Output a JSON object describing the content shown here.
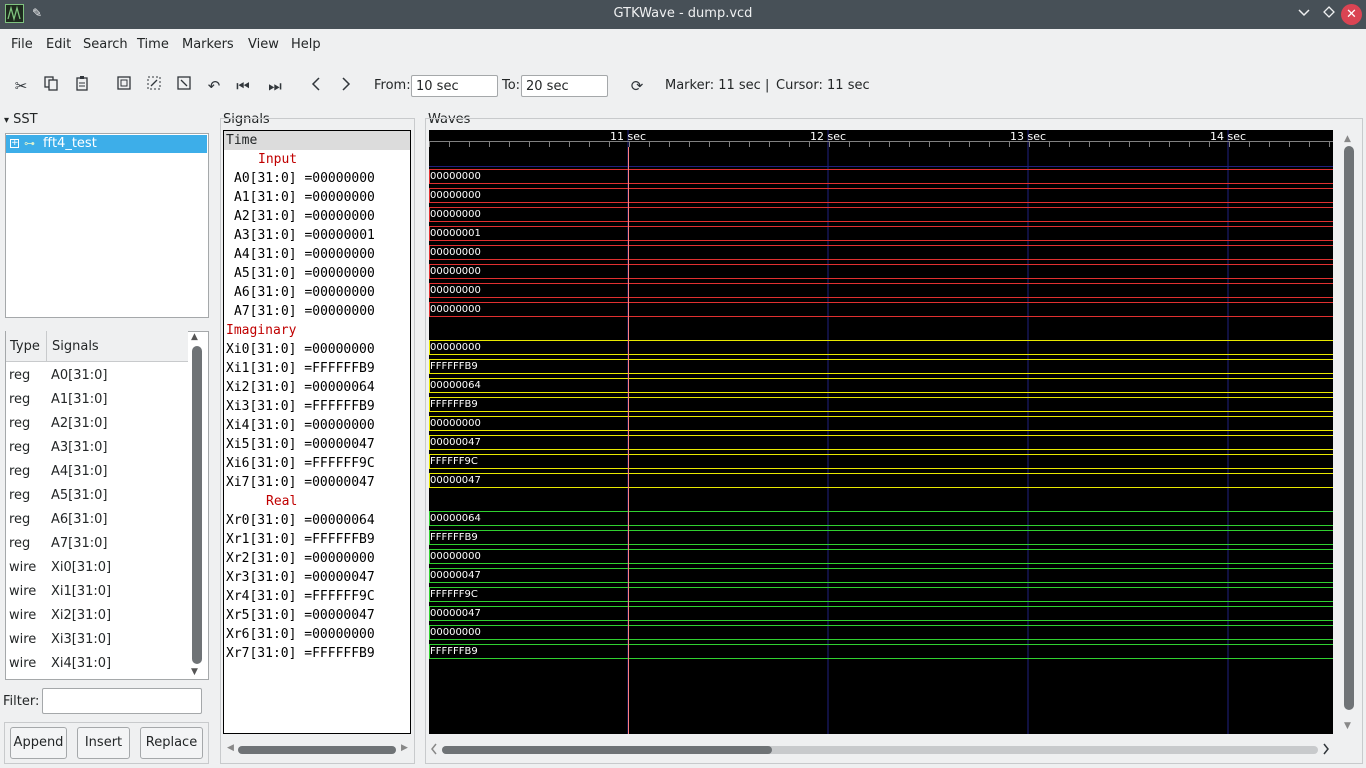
{
  "window": {
    "title": "GTKWave - dump.vcd"
  },
  "menu": [
    "File",
    "Edit",
    "Search",
    "Time",
    "Markers",
    "View",
    "Help"
  ],
  "toolbar": {
    "from_label": "From:",
    "from_value": "10 sec",
    "to_label": "To:",
    "to_value": "20 sec",
    "marker_text": "Marker: 11 sec",
    "separator": "|",
    "cursor_text": "Cursor: 11 sec"
  },
  "sst": {
    "label": "SST",
    "tree_root": "fft4_test",
    "columns": {
      "type": "Type",
      "signals": "Signals"
    },
    "rows": [
      {
        "type": "reg",
        "name": "A0[31:0]"
      },
      {
        "type": "reg",
        "name": "A1[31:0]"
      },
      {
        "type": "reg",
        "name": "A2[31:0]"
      },
      {
        "type": "reg",
        "name": "A3[31:0]"
      },
      {
        "type": "reg",
        "name": "A4[31:0]"
      },
      {
        "type": "reg",
        "name": "A5[31:0]"
      },
      {
        "type": "reg",
        "name": "A6[31:0]"
      },
      {
        "type": "reg",
        "name": "A7[31:0]"
      },
      {
        "type": "wire",
        "name": "Xi0[31:0]"
      },
      {
        "type": "wire",
        "name": "Xi1[31:0]"
      },
      {
        "type": "wire",
        "name": "Xi2[31:0]"
      },
      {
        "type": "wire",
        "name": "Xi3[31:0]"
      },
      {
        "type": "wire",
        "name": "Xi4[31:0]"
      }
    ],
    "filter_label": "Filter:",
    "filter_value": "",
    "buttons": {
      "append": "Append",
      "insert": "Insert",
      "replace": "Replace"
    }
  },
  "signals": {
    "label": "Signals",
    "header": "Time",
    "rows": [
      {
        "text": "Input",
        "group": true
      },
      {
        "text": "A0[31:0] =00000000"
      },
      {
        "text": "A1[31:0] =00000000"
      },
      {
        "text": "A2[31:0] =00000000"
      },
      {
        "text": "A3[31:0] =00000001"
      },
      {
        "text": "A4[31:0] =00000000"
      },
      {
        "text": "A5[31:0] =00000000"
      },
      {
        "text": "A6[31:0] =00000000"
      },
      {
        "text": "A7[31:0] =00000000"
      },
      {
        "text": "Imaginary",
        "group": true
      },
      {
        "text": "Xi0[31:0] =00000000"
      },
      {
        "text": "Xi1[31:0] =FFFFFFB9"
      },
      {
        "text": "Xi2[31:0] =00000064"
      },
      {
        "text": "Xi3[31:0] =FFFFFFB9"
      },
      {
        "text": "Xi4[31:0] =00000000"
      },
      {
        "text": "Xi5[31:0] =00000047"
      },
      {
        "text": "Xi6[31:0] =FFFFFF9C"
      },
      {
        "text": "Xi7[31:0] =00000047"
      },
      {
        "text": "Real",
        "group": true
      },
      {
        "text": "Xr0[31:0] =00000064"
      },
      {
        "text": "Xr1[31:0] =FFFFFFB9"
      },
      {
        "text": "Xr2[31:0] =00000000"
      },
      {
        "text": "Xr3[31:0] =00000047"
      },
      {
        "text": "Xr4[31:0] =FFFFFF9C"
      },
      {
        "text": "Xr5[31:0] =00000047"
      },
      {
        "text": "Xr6[31:0] =00000000"
      },
      {
        "text": "Xr7[31:0] =FFFFFFB9"
      }
    ]
  },
  "waves": {
    "label": "Waves",
    "ticks": [
      "11 sec",
      "12 sec",
      "13 sec",
      "14 sec"
    ],
    "colors": {
      "input": "#e03030",
      "imaginary": "#e8e800",
      "real": "#30d030",
      "cursor": "#ff8080",
      "grid": "#202080"
    },
    "traces": [
      {
        "value": "00000000",
        "group": "input"
      },
      {
        "value": "00000000",
        "group": "input"
      },
      {
        "value": "00000000",
        "group": "input"
      },
      {
        "value": "00000001",
        "group": "input"
      },
      {
        "value": "00000000",
        "group": "input"
      },
      {
        "value": "00000000",
        "group": "input"
      },
      {
        "value": "00000000",
        "group": "input"
      },
      {
        "value": "00000000",
        "group": "input"
      },
      {
        "value": "",
        "group": "blank"
      },
      {
        "value": "00000000",
        "group": "imaginary"
      },
      {
        "value": "FFFFFFB9",
        "group": "imaginary"
      },
      {
        "value": "00000064",
        "group": "imaginary"
      },
      {
        "value": "FFFFFFB9",
        "group": "imaginary"
      },
      {
        "value": "00000000",
        "group": "imaginary"
      },
      {
        "value": "00000047",
        "group": "imaginary"
      },
      {
        "value": "FFFFFF9C",
        "group": "imaginary"
      },
      {
        "value": "00000047",
        "group": "imaginary"
      },
      {
        "value": "",
        "group": "blank"
      },
      {
        "value": "00000064",
        "group": "real"
      },
      {
        "value": "FFFFFFB9",
        "group": "real"
      },
      {
        "value": "00000000",
        "group": "real"
      },
      {
        "value": "00000047",
        "group": "real"
      },
      {
        "value": "FFFFFF9C",
        "group": "real"
      },
      {
        "value": "00000047",
        "group": "real"
      },
      {
        "value": "00000000",
        "group": "real"
      },
      {
        "value": "FFFFFFB9",
        "group": "real"
      }
    ]
  }
}
